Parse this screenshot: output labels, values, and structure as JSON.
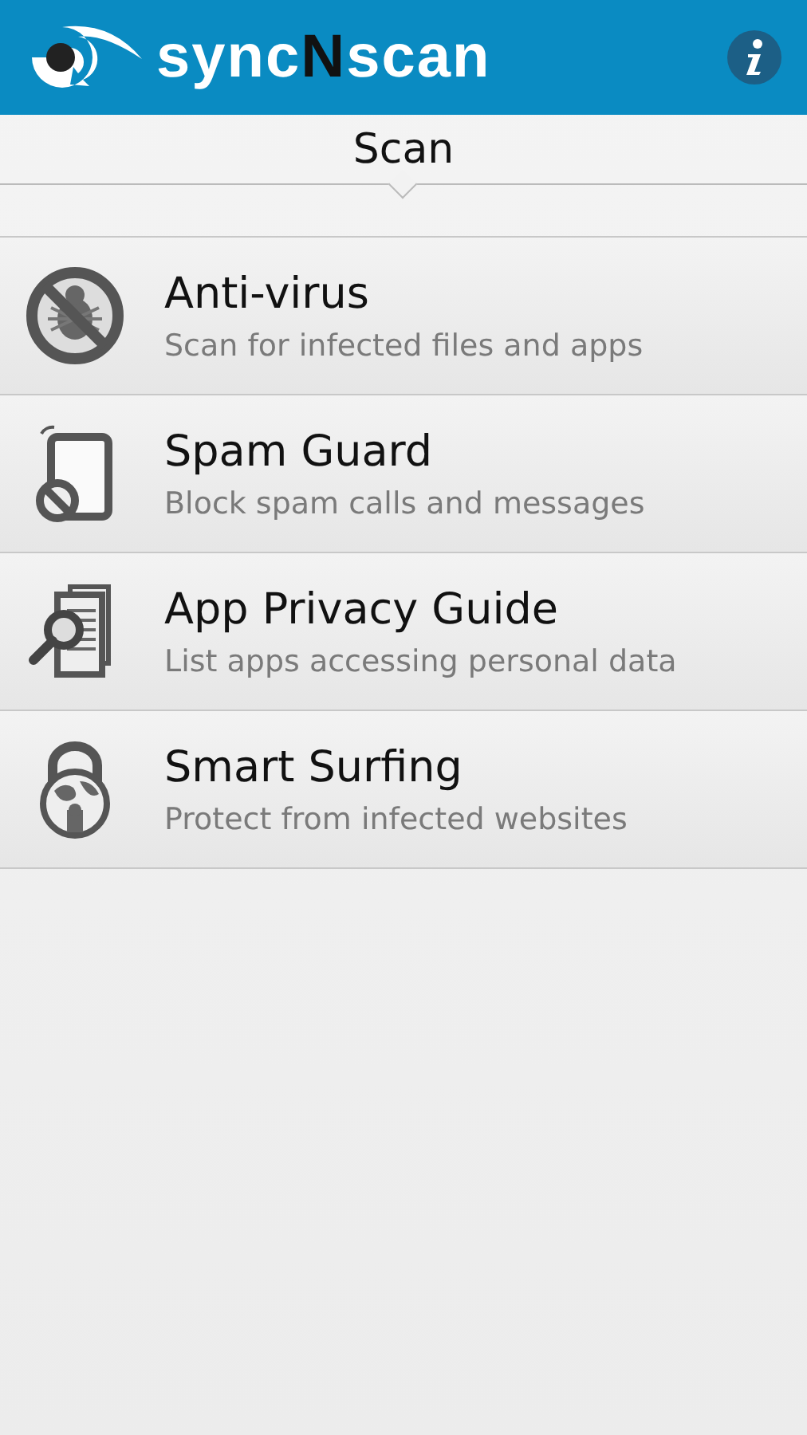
{
  "header": {
    "logo_parts": [
      {
        "text": "sync",
        "kind": "plain"
      },
      {
        "text": "N",
        "kind": "accent"
      },
      {
        "text": "scan",
        "kind": "plain"
      }
    ]
  },
  "tabs": [
    {
      "label": "Scan",
      "selected": true
    }
  ],
  "features": [
    {
      "title": "Anti-virus",
      "subtitle": "Scan for infected files and apps"
    },
    {
      "title": "Spam Guard",
      "subtitle": "Block spam calls and messages"
    },
    {
      "title": "App Privacy Guide",
      "subtitle": "List apps accessing personal data"
    },
    {
      "title": "Smart Surfing",
      "subtitle": "Protect from infected websites"
    }
  ]
}
